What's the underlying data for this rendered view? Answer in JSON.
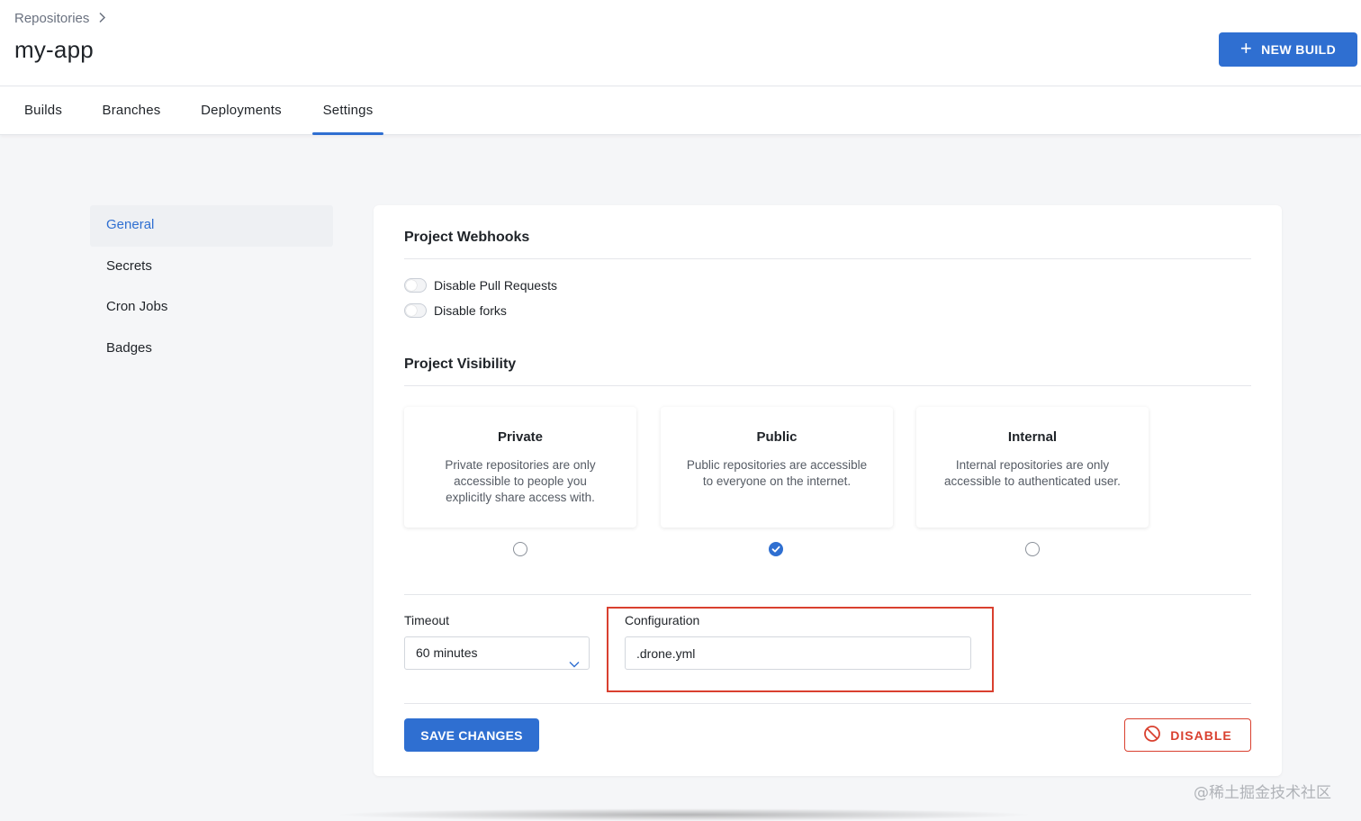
{
  "header": {
    "breadcrumb": "Repositories",
    "title": "my-app",
    "new_build_label": "NEW BUILD"
  },
  "tabs": [
    {
      "label": "Builds",
      "active": false
    },
    {
      "label": "Branches",
      "active": false
    },
    {
      "label": "Deployments",
      "active": false
    },
    {
      "label": "Settings",
      "active": true
    }
  ],
  "sidebar": {
    "items": [
      {
        "label": "General",
        "active": true
      },
      {
        "label": "Secrets",
        "active": false
      },
      {
        "label": "Cron Jobs",
        "active": false
      },
      {
        "label": "Badges",
        "active": false
      }
    ]
  },
  "webhooks": {
    "title": "Project Webhooks",
    "options": [
      {
        "label": "Disable Pull Requests",
        "enabled": false
      },
      {
        "label": "Disable forks",
        "enabled": false
      }
    ]
  },
  "visibility": {
    "title": "Project Visibility",
    "selected": "Public",
    "options": [
      {
        "title": "Private",
        "description": "Private repositories are only accessible to people you explicitly share access with."
      },
      {
        "title": "Public",
        "description": "Public repositories are accessible to everyone on the internet."
      },
      {
        "title": "Internal",
        "description": "Internal repositories are only accessible to authenticated user."
      }
    ]
  },
  "timeout": {
    "label": "Timeout",
    "value": "60 minutes"
  },
  "configuration": {
    "label": "Configuration",
    "value": ".drone.yml"
  },
  "actions": {
    "save_label": "SAVE CHANGES",
    "disable_label": "DISABLE"
  },
  "watermark": "@稀土掘金技术社区",
  "colors": {
    "accent": "#2f6fd1",
    "danger": "#d9402f",
    "highlight_box": "#d9402f"
  }
}
